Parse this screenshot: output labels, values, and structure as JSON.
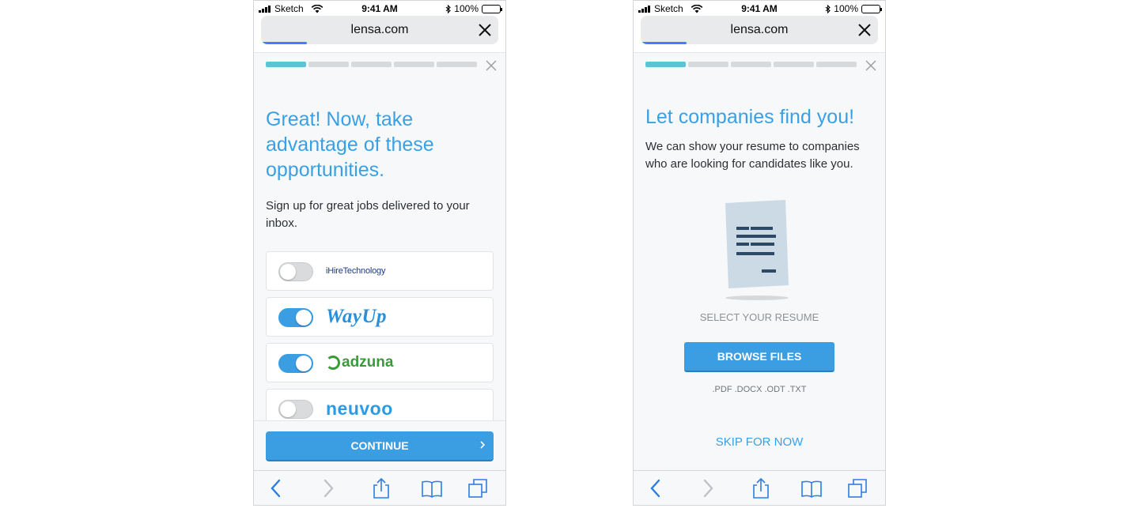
{
  "status": {
    "carrier": "Sketch",
    "time": "9:41 AM",
    "battery": "100%"
  },
  "browser": {
    "url": "lensa.com"
  },
  "screen1": {
    "title": "Great! Now, take advantage of these opportunities.",
    "subtitle": "Sign up for great jobs delivered to your inbox.",
    "progress": {
      "step": 1,
      "total": 5
    },
    "partners": [
      {
        "name": "iHireTechnology",
        "enabled": false
      },
      {
        "name": "WayUp",
        "enabled": true
      },
      {
        "name": "adzuna",
        "enabled": true
      },
      {
        "name": "neuvoo",
        "enabled": false
      }
    ],
    "continue_label": "CONTINUE"
  },
  "screen2": {
    "title": "Let companies find you!",
    "subtitle": "We can show your resume to companies who are looking for candidates like you.",
    "progress": {
      "step": 1,
      "total": 5
    },
    "select_label": "SELECT YOUR RESUME",
    "browse_label": "BROWSE FILES",
    "formats": ".PDF .DOCX .ODT .TXT",
    "skip_label": "SKIP FOR NOW"
  },
  "colors": {
    "accent": "#3b9ee3",
    "progress_active": "#5bc4d4",
    "title": "#3aa0e5"
  }
}
